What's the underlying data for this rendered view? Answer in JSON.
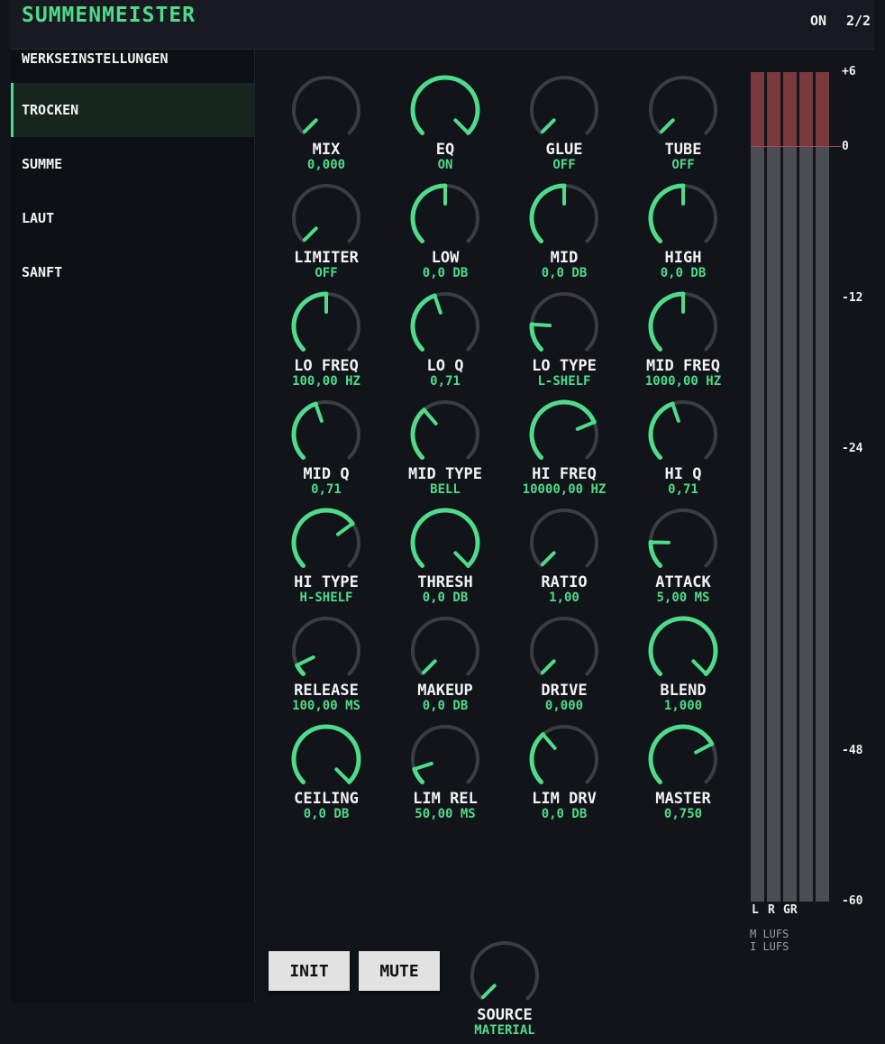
{
  "header": {
    "title": "SUMMENMEISTER",
    "power": "ON",
    "page": "2/2"
  },
  "colors": {
    "accent": "#4fdb8a",
    "background": "#111419",
    "meter_clip": "#7a3a3d",
    "knob_track": "#3a3d42"
  },
  "presets": [
    {
      "label": "WERKSEINSTELLUNGEN",
      "active": false
    },
    {
      "label": "TROCKEN",
      "active": true
    },
    {
      "label": "SUMME",
      "active": false
    },
    {
      "label": "LAUT",
      "active": false
    },
    {
      "label": "SANFT",
      "active": false
    }
  ],
  "knobs": [
    {
      "name": "MIX",
      "value": "0,000",
      "level": 0.0
    },
    {
      "name": "EQ",
      "value": "ON",
      "level": 1.0
    },
    {
      "name": "GLUE",
      "value": "OFF",
      "level": 0.0
    },
    {
      "name": "TUBE",
      "value": "OFF",
      "level": 0.0
    },
    {
      "name": "LIMITER",
      "value": "OFF",
      "level": 0.0
    },
    {
      "name": "LOW",
      "value": "0,0 DB",
      "level": 0.5
    },
    {
      "name": "MID",
      "value": "0,0 DB",
      "level": 0.5
    },
    {
      "name": "HIGH",
      "value": "0,0 DB",
      "level": 0.5
    },
    {
      "name": "LO FREQ",
      "value": "100,00 HZ",
      "level": 0.5
    },
    {
      "name": "LO Q",
      "value": "0,71",
      "level": 0.43
    },
    {
      "name": "LO TYPE",
      "value": "L-SHELF",
      "level": 0.18
    },
    {
      "name": "MID FREQ",
      "value": "1000,00 HZ",
      "level": 0.5
    },
    {
      "name": "MID Q",
      "value": "0,71",
      "level": 0.43
    },
    {
      "name": "MID TYPE",
      "value": "BELL",
      "level": 0.35
    },
    {
      "name": "HI FREQ",
      "value": "10000,00 HZ",
      "level": 0.75
    },
    {
      "name": "HI Q",
      "value": "0,71",
      "level": 0.43
    },
    {
      "name": "HI TYPE",
      "value": "H-SHELF",
      "level": 0.7
    },
    {
      "name": "THRESH",
      "value": "0,0 DB",
      "level": 1.0
    },
    {
      "name": "RATIO",
      "value": "1,00",
      "level": 0.0
    },
    {
      "name": "ATTACK",
      "value": "5,00 MS",
      "level": 0.17
    },
    {
      "name": "RELEASE",
      "value": "100,00 MS",
      "level": 0.07
    },
    {
      "name": "MAKEUP",
      "value": "0,0 DB",
      "level": 0.0
    },
    {
      "name": "DRIVE",
      "value": "0,000",
      "level": 0.0
    },
    {
      "name": "BLEND",
      "value": "1,000",
      "level": 1.0
    },
    {
      "name": "CEILING",
      "value": "0,0 DB",
      "level": 1.0
    },
    {
      "name": "LIM REL",
      "value": "50,00 MS",
      "level": 0.1
    },
    {
      "name": "LIM DRV",
      "value": "0,0 DB",
      "level": 0.35
    },
    {
      "name": "MASTER",
      "value": "0,750",
      "level": 0.73
    },
    {
      "name": "SOURCE",
      "value": "MATERIAL",
      "level": 0.0
    }
  ],
  "buttons": {
    "init": "INIT",
    "mute": "MUTE"
  },
  "meter": {
    "scale": [
      "+6",
      "0",
      "-12",
      "-24",
      "-48",
      "-60"
    ],
    "scale_db": [
      6,
      0,
      -12,
      -24,
      -48,
      -60
    ],
    "range_db": [
      -60,
      6
    ],
    "channels": [
      "L",
      "R",
      "GR"
    ],
    "lufs": [
      "M LUFS",
      "I LUFS"
    ]
  }
}
